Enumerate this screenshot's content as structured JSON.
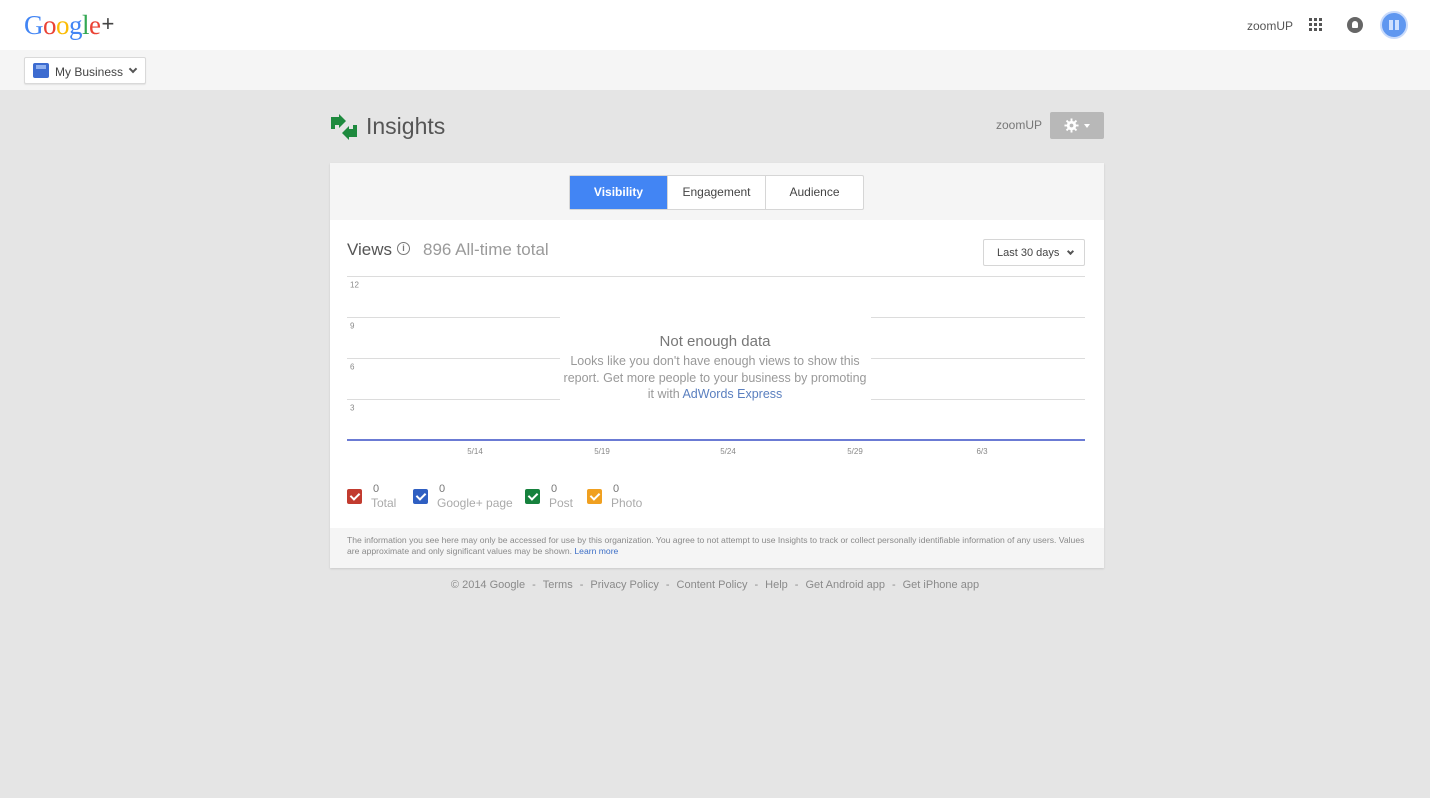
{
  "topbar": {
    "logo_letters": [
      "G",
      "o",
      "o",
      "g",
      "l",
      "e"
    ],
    "logo_plus": "+",
    "user_name": "zoomUP"
  },
  "subbar": {
    "business_label": "My Business"
  },
  "header": {
    "title": "Insights",
    "user_name": "zoomUP"
  },
  "tabs": [
    {
      "label": "Visibility",
      "active": true
    },
    {
      "label": "Engagement",
      "active": false
    },
    {
      "label": "Audience",
      "active": false
    }
  ],
  "views": {
    "title": "Views",
    "info_glyph": "i",
    "total": "896 All-time total",
    "range": "Last 30 days"
  },
  "chart_data": {
    "type": "line",
    "title": "",
    "xlabel": "",
    "ylabel": "",
    "y_ticks": [
      "12",
      "9",
      "6",
      "3"
    ],
    "x_ticks": [
      "5/14",
      "5/19",
      "5/24",
      "5/29",
      "6/3"
    ],
    "ylim": [
      0,
      12
    ],
    "grid": true,
    "series": [],
    "baseline_color": "#6b7bd4"
  },
  "no_data": {
    "title": "Not enough data",
    "text": "Looks like you don't have enough views to show this report. Get more people to your business by promoting it with ",
    "link": "AdWords Express"
  },
  "legend": [
    {
      "value": "0",
      "label": "Total",
      "color": "#c23b2f"
    },
    {
      "value": "0",
      "label": "Google+ page",
      "color": "#2f5fc2"
    },
    {
      "value": "0",
      "label": "Post",
      "color": "#16813d"
    },
    {
      "value": "0",
      "label": "Photo",
      "color": "#f0a020"
    }
  ],
  "disclaimer": {
    "text": "The information you see here may only be accessed for use by this organization. You agree to not attempt to use Insights to track or collect personally identifiable information of any users. Values are approximate and only significant values may be shown. ",
    "link": "Learn more"
  },
  "footer": {
    "links": [
      "© 2014 Google",
      "Terms",
      "Privacy Policy",
      "Content Policy",
      "Help",
      "Get Android app",
      "Get iPhone app"
    ],
    "separator": "-"
  }
}
